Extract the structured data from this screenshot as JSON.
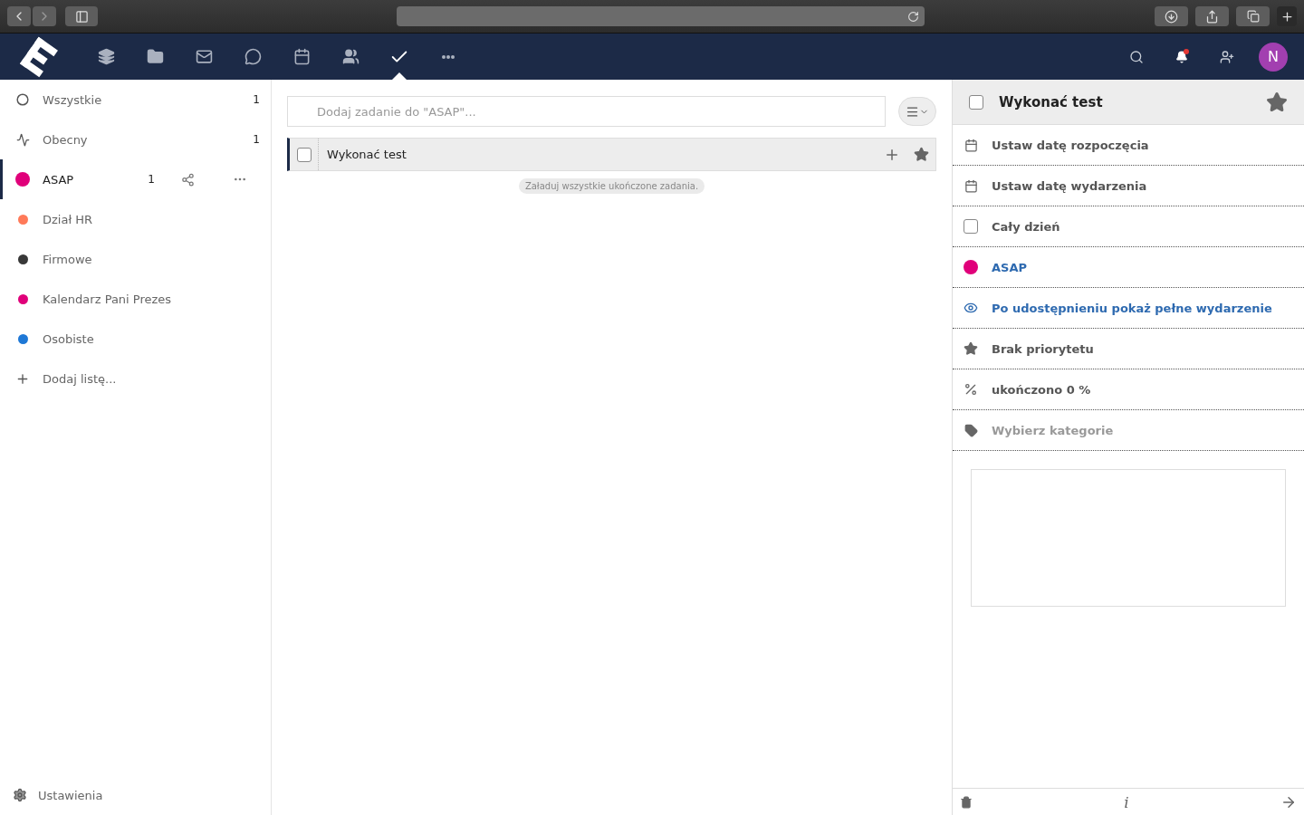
{
  "nav": {
    "apps": [
      {
        "kind": "stack",
        "selected": false
      },
      {
        "kind": "folder",
        "selected": false
      },
      {
        "kind": "mail",
        "selected": false
      },
      {
        "kind": "chat",
        "selected": false
      },
      {
        "kind": "calendar",
        "selected": false
      },
      {
        "kind": "contacts",
        "selected": false
      },
      {
        "kind": "tasks",
        "selected": true
      },
      {
        "kind": "more",
        "selected": false
      }
    ],
    "notifications_unread": true,
    "avatar": "N"
  },
  "sidebar": {
    "items": [
      {
        "kind": "all",
        "label": "Wszystkie",
        "count": "1",
        "selected": false
      },
      {
        "kind": "current",
        "label": "Obecny",
        "count": "1",
        "selected": false
      },
      {
        "kind": "list",
        "label": "ASAP",
        "count": "1",
        "color": "#e0007a",
        "selected": true
      },
      {
        "kind": "list",
        "label": "Dział HR",
        "color": "#ff7a59",
        "selected": false
      },
      {
        "kind": "list",
        "label": "Firmowe",
        "color": "#383838",
        "selected": false
      },
      {
        "kind": "list",
        "label": "Kalendarz Pani Prezes",
        "color": "#e0007a",
        "selected": false
      },
      {
        "kind": "list",
        "label": "Osobiste",
        "color": "#1e78d6",
        "selected": false
      },
      {
        "kind": "add",
        "label": "Dodaj listę..."
      }
    ],
    "settings": "Ustawienia"
  },
  "tasks": {
    "placeholder": "Dodaj zadanie do \"ASAP\"...",
    "items": [
      {
        "title": "Wykonać test",
        "checked": false,
        "starred": false,
        "selected": true
      }
    ],
    "load_completed": "Załaduj wszystkie ukończone zadania."
  },
  "details": {
    "title": "Wykonać test",
    "checked": false,
    "starred": false,
    "fields": [
      {
        "kind": "date",
        "label": "Ustaw datę rozpoczęcia"
      },
      {
        "kind": "date",
        "label": "Ustaw datę wydarzenia"
      },
      {
        "kind": "checkbox",
        "label": "Cały dzień",
        "checked": false
      },
      {
        "kind": "calendar",
        "label": "ASAP",
        "color": "#e0007a"
      },
      {
        "kind": "visibility",
        "label": "Po udostępnieniu pokaż pełne wydarzenie"
      },
      {
        "kind": "priority",
        "label": "Brak priorytetu"
      },
      {
        "kind": "percent",
        "label": "ukończono 0 %"
      },
      {
        "kind": "category",
        "placeholder": "Wybierz kategorie"
      }
    ],
    "info_glyph": "i"
  }
}
